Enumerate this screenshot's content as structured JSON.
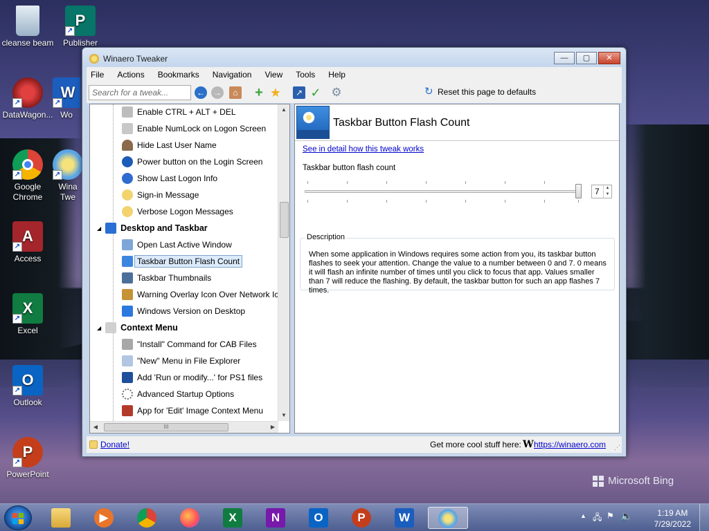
{
  "desktop": {
    "icons": [
      {
        "label": "cleanse beam"
      },
      {
        "label": "Publisher"
      },
      {
        "label": "DataWagon..."
      },
      {
        "label": "Wo"
      },
      {
        "label": "Google Chrome"
      },
      {
        "label": "Wina Twe"
      },
      {
        "label": "Access"
      },
      {
        "label": "Excel"
      },
      {
        "label": "Outlook"
      },
      {
        "label": "PowerPoint"
      }
    ],
    "watermark": "Microsoft Bing"
  },
  "window": {
    "title": "Winaero Tweaker",
    "controls": {
      "minimize": "—",
      "maximize": "▢",
      "close": "✕"
    }
  },
  "menu": [
    "File",
    "Actions",
    "Bookmarks",
    "Navigation",
    "View",
    "Tools",
    "Help"
  ],
  "toolbar": {
    "search_placeholder": "Search for a tweak...",
    "reset_label": "Reset this page to defaults"
  },
  "tree": {
    "items": [
      {
        "label": "Enable CTRL + ALT + DEL",
        "icon_color": "#bdbdbd"
      },
      {
        "label": "Enable NumLock on Logon Screen",
        "icon_color": "#c8c8c8"
      },
      {
        "label": "Hide Last User Name",
        "icon_color": "#8a6a4a"
      },
      {
        "label": "Power button on the Login Screen",
        "icon_color": "#1c5bb8"
      },
      {
        "label": "Show Last Logon Info",
        "icon_color": "#2f6bd0"
      },
      {
        "label": "Sign-in Message",
        "icon_color": "#f2d36e"
      },
      {
        "label": "Verbose Logon Messages",
        "icon_color": "#f2d36e"
      },
      {
        "label": "Desktop and Taskbar",
        "icon_color": "#2a6fd3",
        "category": true
      },
      {
        "label": "Open Last Active Window",
        "icon_color": "#7ea7d8"
      },
      {
        "label": "Taskbar Button Flash Count",
        "icon_color": "#3d86dd",
        "selected": true
      },
      {
        "label": "Taskbar Thumbnails",
        "icon_color": "#4c6f9a"
      },
      {
        "label": "Warning Overlay Icon Over Network Icon in",
        "icon_color": "#c59236"
      },
      {
        "label": "Windows Version on Desktop",
        "icon_color": "#2c7ae0"
      },
      {
        "label": "Context Menu",
        "icon_color": "#d0d0d0",
        "category": true
      },
      {
        "label": "\"Install\" Command for CAB Files",
        "icon_color": "#a8a8a8"
      },
      {
        "label": "\"New\" Menu in File Explorer",
        "icon_color": "#b0c6e3"
      },
      {
        "label": "Add 'Run or modify...' for PS1 files",
        "icon_color": "#1f4f9c"
      },
      {
        "label": "Advanced Startup Options",
        "icon_color": "#6f6f6f"
      },
      {
        "label": "App for 'Edit' Image Context Menu",
        "icon_color": "#b33a2a"
      }
    ],
    "hscroll_grip": "III"
  },
  "content": {
    "title": "Taskbar Button Flash Count",
    "detail_link": "See in detail how this tweak works",
    "setting_label": "Taskbar button flash count",
    "slider": {
      "value": 7,
      "min": 0,
      "max": 7
    },
    "spin_value": "7",
    "description_title": "Description",
    "description": "When some application in Windows requires some action from you, its taskbar button flashes to seek your attention. Change the value to a number between 0 and 7. 0 means it will flash an infinite number of times until you click to focus that app. Values smaller than 7 will reduce the flashing. By default, the taskbar button for such an app flashes 7 times."
  },
  "statusbar": {
    "donate": "Donate!",
    "more": "Get more cool stuff here:",
    "logo": "W",
    "url": "https://winaero.com"
  },
  "taskbar": {
    "apps": [
      "File Explorer",
      "Media Player",
      "Google Chrome",
      "Firefox",
      "Excel",
      "OneNote",
      "Outlook",
      "PowerPoint",
      "Word",
      "Winaero Tweaker"
    ],
    "time": "1:19 AM",
    "date": "7/29/2022"
  }
}
